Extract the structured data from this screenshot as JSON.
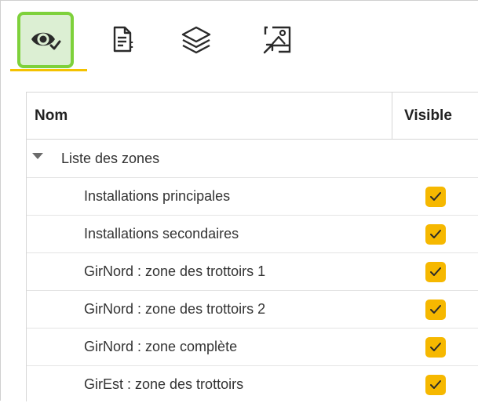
{
  "toolbar": {
    "tools": [
      {
        "icon": "eye-check-icon",
        "active": true
      },
      {
        "icon": "document-list-icon",
        "active": false
      },
      {
        "icon": "layers-icon",
        "active": false
      },
      {
        "icon": "image-export-icon",
        "active": false
      }
    ],
    "active_tab_color": "#f4c200",
    "active_highlight_color": "#7ed13b"
  },
  "table": {
    "columns": [
      "Nom",
      "Visible"
    ],
    "group": {
      "label": "Liste des zones",
      "expanded": true,
      "items": [
        {
          "label": "Installations principales",
          "visible": true
        },
        {
          "label": "Installations secondaires",
          "visible": true
        },
        {
          "label": "GirNord : zone des trottoirs 1",
          "visible": true
        },
        {
          "label": "GirNord : zone des trottoirs 2",
          "visible": true
        },
        {
          "label": "GirNord : zone complète",
          "visible": true
        },
        {
          "label": "GirEst : zone des trottoirs",
          "visible": true
        }
      ]
    },
    "checkbox_color": "#f6b800"
  }
}
